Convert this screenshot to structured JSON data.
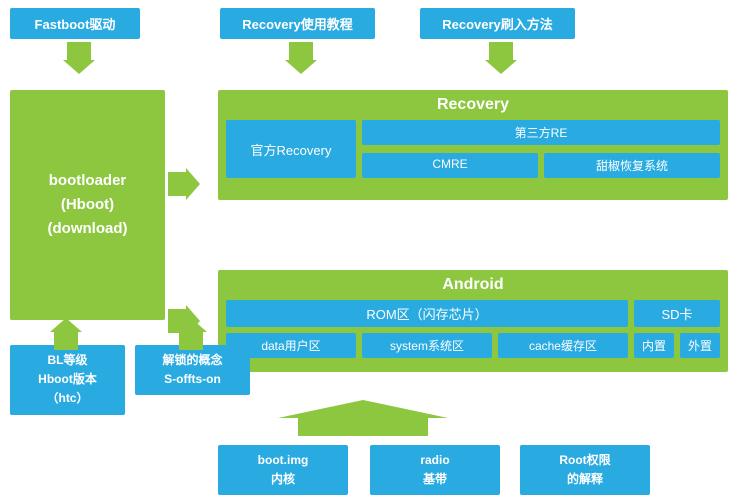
{
  "top_buttons": {
    "fastboot": "Fastboot驱动",
    "recovery_tutorial": "Recovery使用教程",
    "recovery_flash": "Recovery刷入方法"
  },
  "bootloader": {
    "line1": "bootloader",
    "line2": "(Hboot)",
    "line3": "(download)"
  },
  "recovery_section": {
    "title": "Recovery",
    "official": "官方Recovery",
    "third_re_label": "第三方RE",
    "cmre": "CMRE",
    "sweet_pepper": "甜椒恢复系统"
  },
  "android_section": {
    "title": "Android",
    "rom_label": "ROM区（闪存芯片）",
    "sd_label": "SD卡",
    "data_label": "data用户区",
    "system_label": "system系统区",
    "cache_label": "cache缓存区",
    "internal": "内置",
    "external": "外置"
  },
  "bottom_boxes": {
    "bl_grade": "BL等级\nHboot版本\n（htc）",
    "unlock_concept": "解锁的概念\nS-offts-on",
    "boot_img": "boot.img\n内核",
    "radio": "radio\n基带",
    "root": "Root权限\n的解释"
  }
}
